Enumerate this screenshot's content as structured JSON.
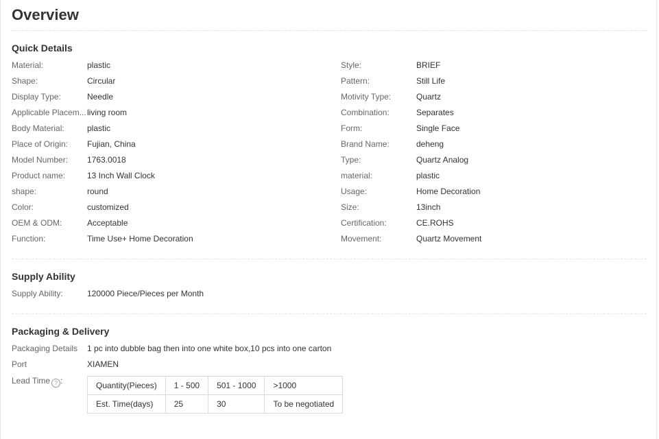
{
  "page": {
    "title": "Overview"
  },
  "quick_details": {
    "heading": "Quick Details",
    "left": [
      {
        "label": "Material:",
        "value": "plastic"
      },
      {
        "label": "Shape:",
        "value": "Circular"
      },
      {
        "label": "Display Type:",
        "value": "Needle"
      },
      {
        "label": "Applicable Placem...",
        "value": "living room"
      },
      {
        "label": "Body Material:",
        "value": "plastic"
      },
      {
        "label": "Place of Origin:",
        "value": "Fujian, China"
      },
      {
        "label": "Model Number:",
        "value": "1763.0018"
      },
      {
        "label": "Product name:",
        "value": "13 Inch Wall Clock"
      },
      {
        "label": "shape:",
        "value": "round"
      },
      {
        "label": "Color:",
        "value": "customized"
      },
      {
        "label": "OEM & ODM:",
        "value": "Acceptable"
      },
      {
        "label": "Function:",
        "value": "Time Use+ Home Decoration"
      }
    ],
    "right": [
      {
        "label": "Style:",
        "value": "BRIEF"
      },
      {
        "label": "Pattern:",
        "value": "Still Life"
      },
      {
        "label": "Motivity Type:",
        "value": "Quartz"
      },
      {
        "label": "Combination:",
        "value": "Separates"
      },
      {
        "label": "Form:",
        "value": "Single Face"
      },
      {
        "label": "Brand Name:",
        "value": "deheng"
      },
      {
        "label": "Type:",
        "value": "Quartz Analog"
      },
      {
        "label": "material:",
        "value": "plastic"
      },
      {
        "label": "Usage:",
        "value": "Home Decoration"
      },
      {
        "label": "Size:",
        "value": "13inch"
      },
      {
        "label": "Certification:",
        "value": "CE.ROHS"
      },
      {
        "label": "Movement:",
        "value": "Quartz Movement"
      }
    ]
  },
  "supply": {
    "heading": "Supply Ability",
    "label": "Supply Ability:",
    "value": "120000 Piece/Pieces per Month"
  },
  "packaging": {
    "heading": "Packaging & Delivery",
    "details_label": "Packaging Details",
    "details_value": "1 pc into dubble bag then into one white box,10 pcs into one carton",
    "port_label": "Port",
    "port_value": "XIAMEN",
    "lead_label": "Lead Time",
    "help_icon": "question-circle-icon",
    "help_glyph": "?",
    "lead_colon": ":",
    "lead_table": {
      "header": [
        "Quantity(Pieces)",
        "1 - 500",
        "501 - 1000",
        ">1000"
      ],
      "row": [
        "Est. Time(days)",
        "25",
        "30",
        "To be negotiated"
      ]
    }
  }
}
